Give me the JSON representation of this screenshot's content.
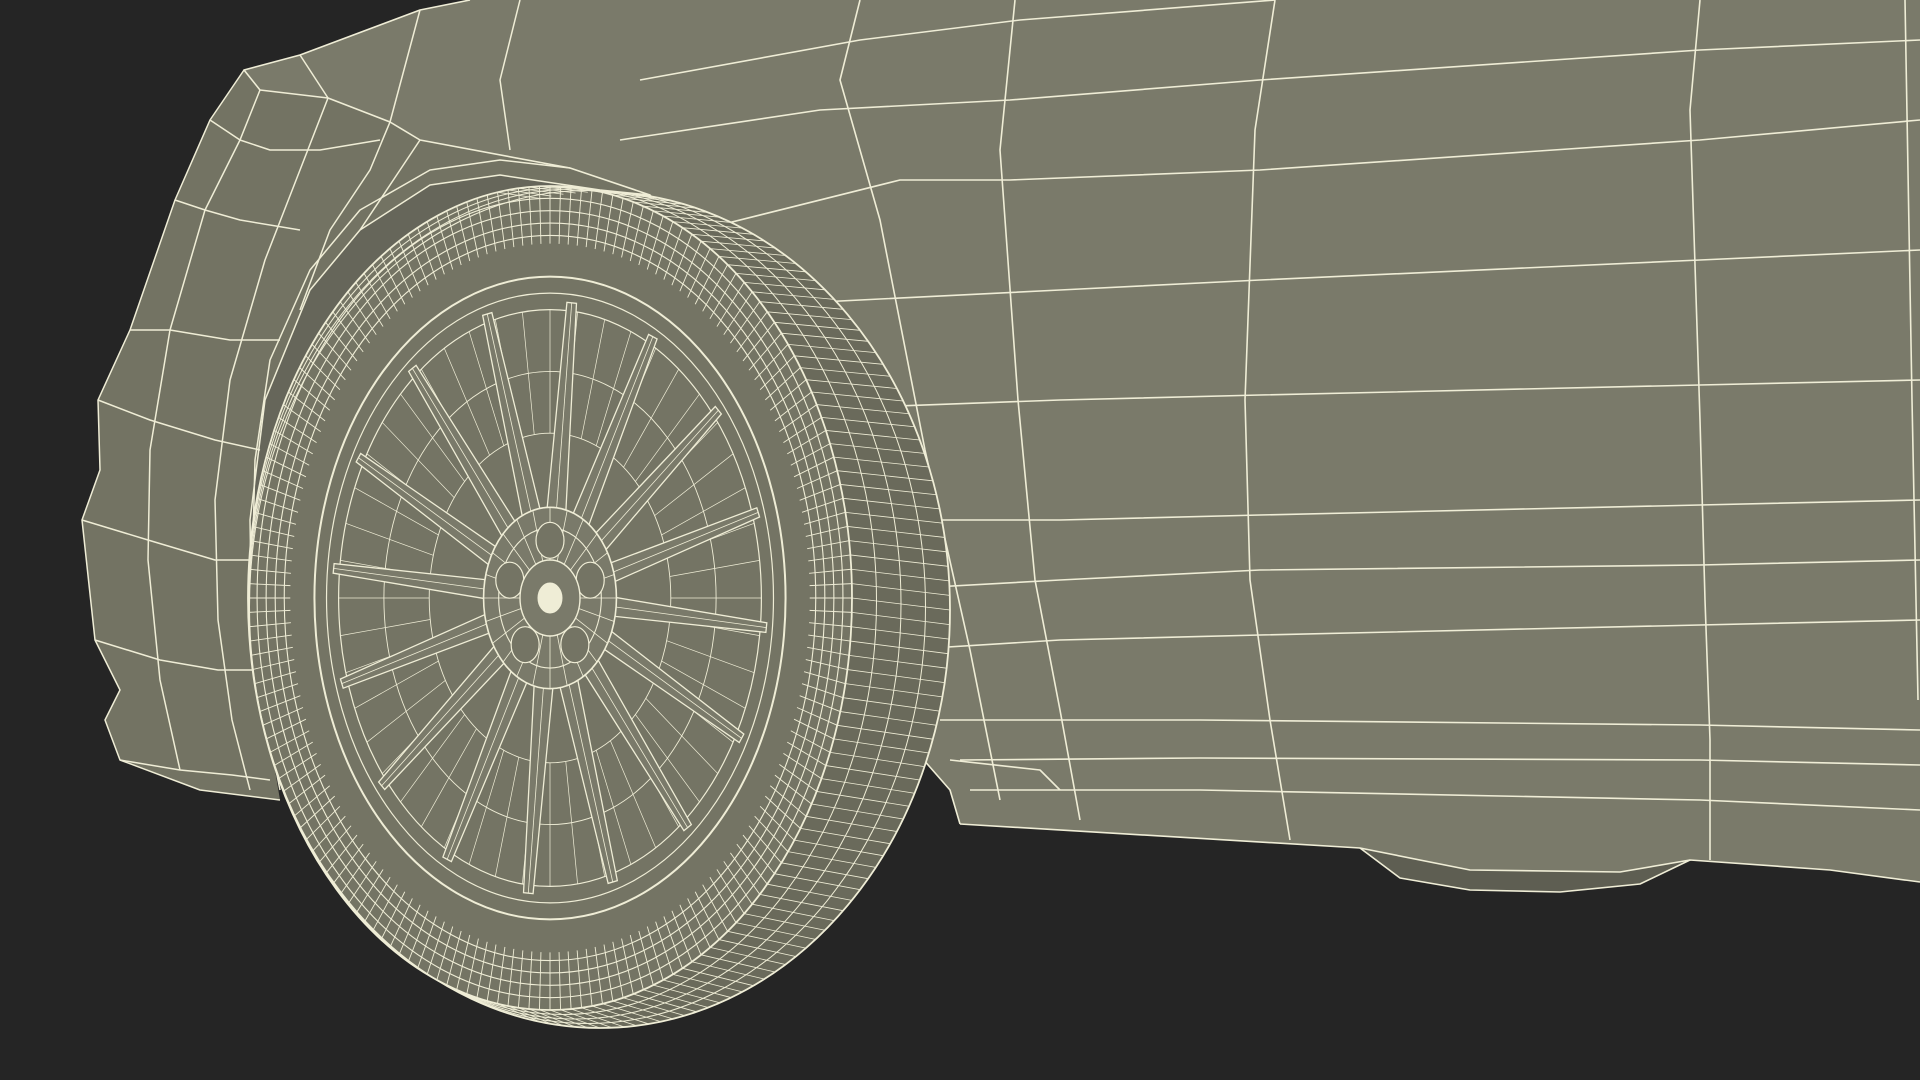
{
  "scene": {
    "subject": "wireframe-car-front-wheel",
    "colors": {
      "background": "#252525",
      "body_fill": "#7a7a6a",
      "shadow_fill": "#6a6a5b",
      "wheel_fill": "#747464",
      "wire": "#efedd6"
    },
    "wheel": {
      "spoke_count": 16,
      "tire_segment_count": 180,
      "lug_nut_count": 5
    }
  }
}
